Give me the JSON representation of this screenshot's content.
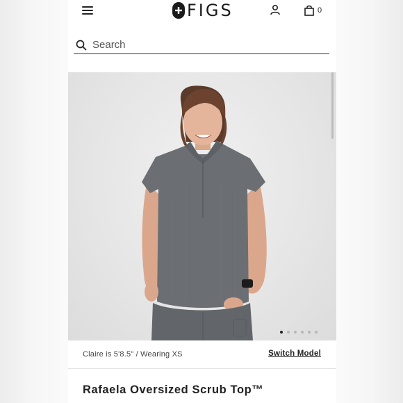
{
  "header": {
    "brand": "FIGS",
    "cart_count": "0",
    "icons": [
      "menu-icon",
      "figs-logo-plus-icon",
      "account-icon",
      "shopping-bag-icon"
    ]
  },
  "search": {
    "placeholder": "Search"
  },
  "gallery": {
    "image_count": 6,
    "active_index": 0
  },
  "model_bar": {
    "info": "Claire is 5'8.5\" / Wearing XS",
    "switch_label": "Switch Model"
  },
  "product": {
    "title": "Rafaela Oversized Scrub Top™"
  },
  "colors": {
    "brand_dark": "#1b1b1b",
    "scrub_gray": "#6b6f73",
    "background": "#ffffff"
  }
}
